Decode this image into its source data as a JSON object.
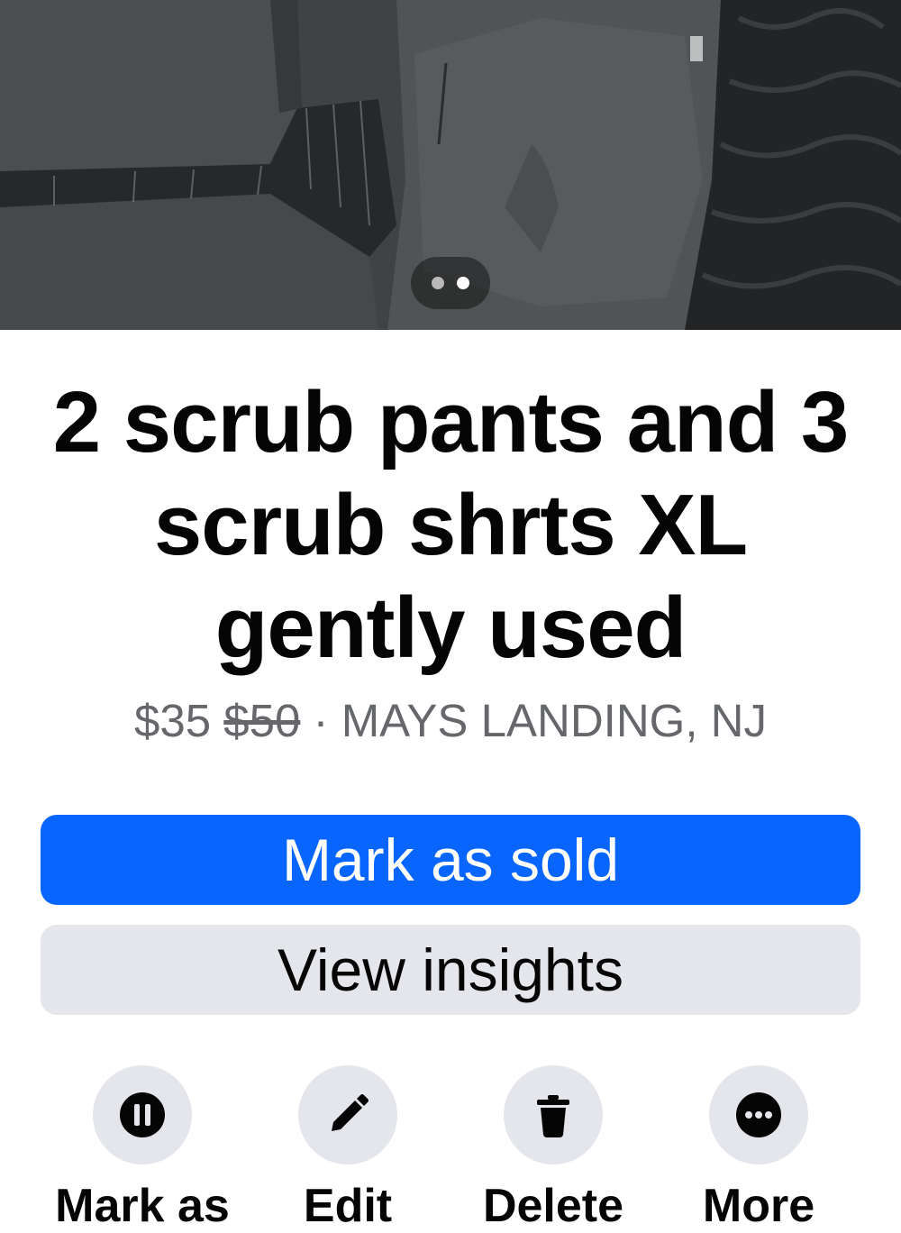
{
  "listing": {
    "title": "2 scrub pants and 3 scrub shrts XL gently used",
    "price": "$35",
    "original_price": "$50",
    "separator": "·",
    "location": "MAYS LANDING, NJ"
  },
  "gallery": {
    "photo_count": 2,
    "active_index": 1
  },
  "buttons": {
    "primary_label": "Mark as sold",
    "secondary_label": "View insights"
  },
  "actions": [
    {
      "label": "Mark as",
      "icon": "pause-icon"
    },
    {
      "label": "Edit",
      "icon": "pencil-icon"
    },
    {
      "label": "Delete",
      "icon": "trash-icon"
    },
    {
      "label": "More",
      "icon": "more-dots-icon"
    }
  ],
  "colors": {
    "primary": "#0866ff",
    "secondary_bg": "#e4e6eb",
    "meta_text": "#65676b"
  }
}
